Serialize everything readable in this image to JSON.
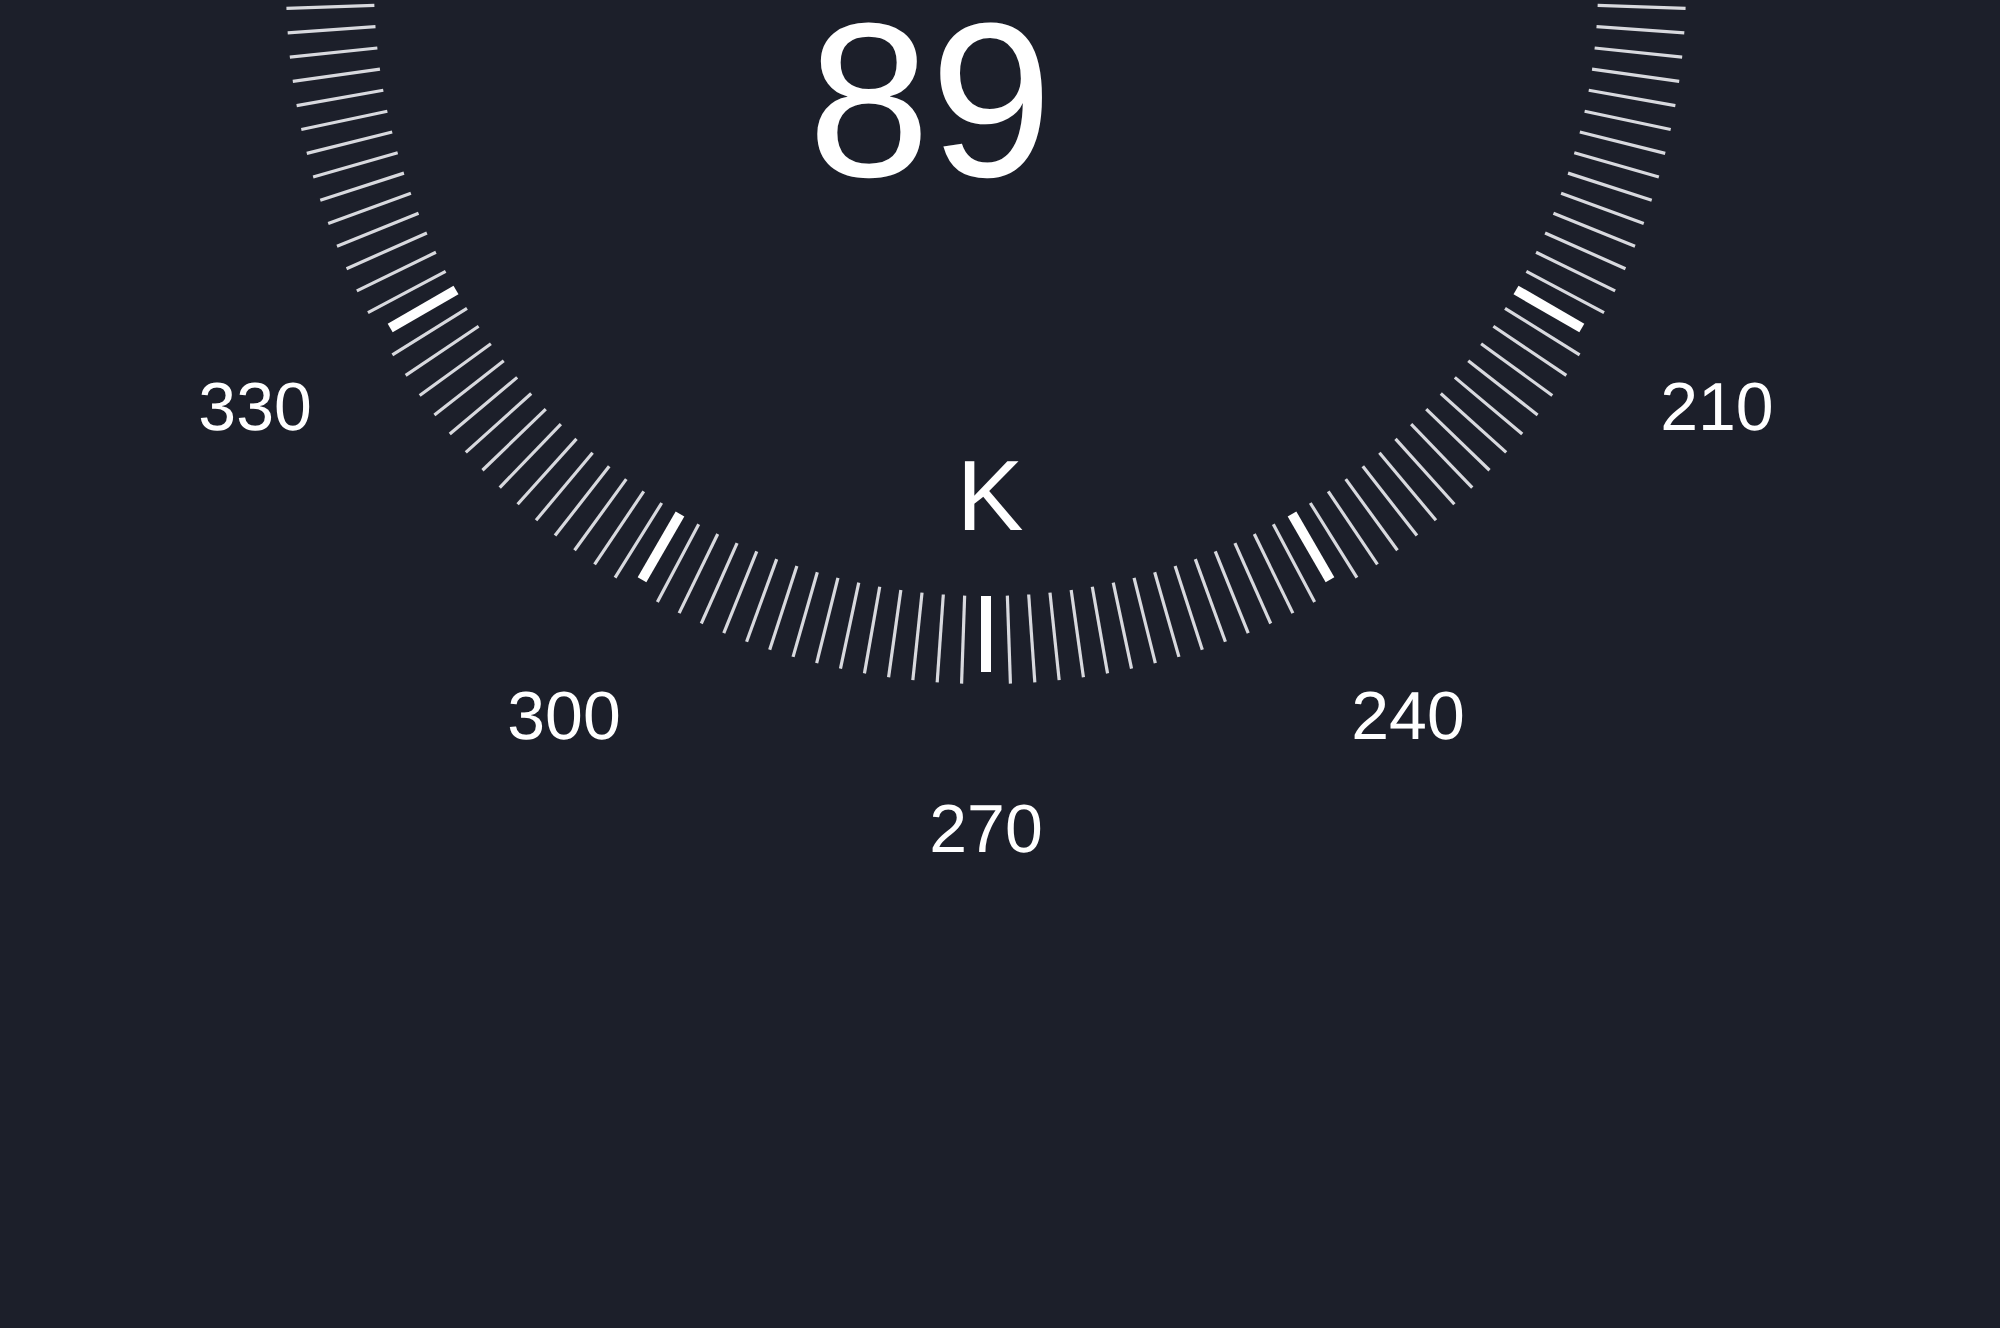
{
  "compass": {
    "heading": "89",
    "cardinal": "K",
    "scale_labels": [
      "330",
      "300",
      "270",
      "240",
      "210"
    ]
  }
}
